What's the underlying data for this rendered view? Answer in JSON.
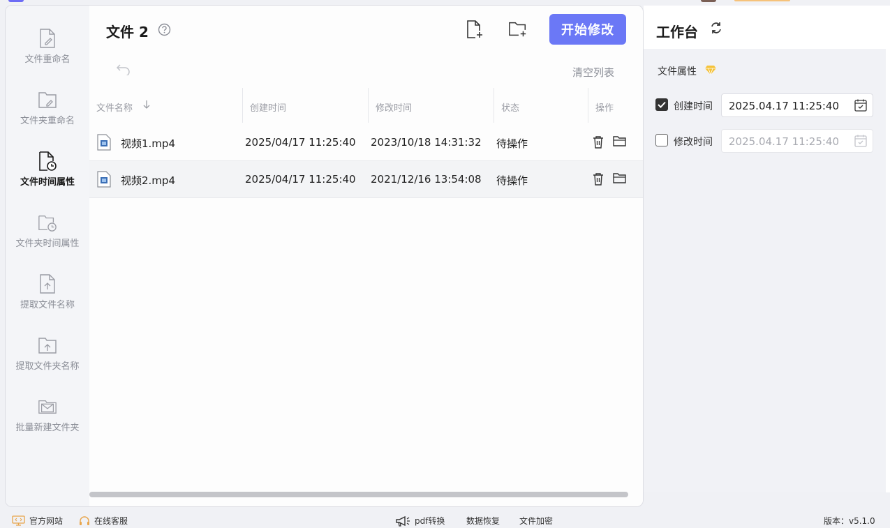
{
  "header": {
    "title": "文件 2",
    "start_button": "开始修改",
    "clear_list": "清空列表"
  },
  "sidebar": {
    "items": [
      {
        "label": "文件重命名",
        "icon": "file-edit-icon",
        "active": false
      },
      {
        "label": "文件夹重命名",
        "icon": "folder-edit-icon",
        "active": false
      },
      {
        "label": "文件时间属性",
        "icon": "file-clock-icon",
        "active": true
      },
      {
        "label": "文件夹时间属性",
        "icon": "folder-clock-icon",
        "active": false
      },
      {
        "label": "提取文件名称",
        "icon": "file-upload-icon",
        "active": false
      },
      {
        "label": "提取文件夹名称",
        "icon": "folder-upload-icon",
        "active": false
      },
      {
        "label": "批量新建文件夹",
        "icon": "folder-mail-icon",
        "active": false
      }
    ]
  },
  "table": {
    "columns": [
      "文件名称",
      "创建时间",
      "修改时间",
      "状态",
      "操作"
    ],
    "rows": [
      {
        "name": "视频1.mp4",
        "created": "2025/04/17 11:25:40",
        "modified": "2023/10/18 14:31:32",
        "status": "待操作"
      },
      {
        "name": "视频2.mp4",
        "created": "2025/04/17 11:25:40",
        "modified": "2021/12/16 13:54:08",
        "status": "待操作"
      }
    ]
  },
  "workspace": {
    "title": "工作台",
    "section_title": "文件属性",
    "create_time": {
      "label": "创建时间",
      "checked": true,
      "value": "2025.04.17 11:25:40"
    },
    "modify_time": {
      "label": "修改时间",
      "checked": false,
      "value": "2025.04.17 11:25:40"
    }
  },
  "footer": {
    "website": "官方网站",
    "support": "在线客服",
    "pdf": "pdf转换",
    "recovery": "数据恢复",
    "encrypt": "文件加密",
    "version": "版本：v5.1.0"
  },
  "colors": {
    "accent": "#6b78f6",
    "vip": "#f5c33b"
  }
}
